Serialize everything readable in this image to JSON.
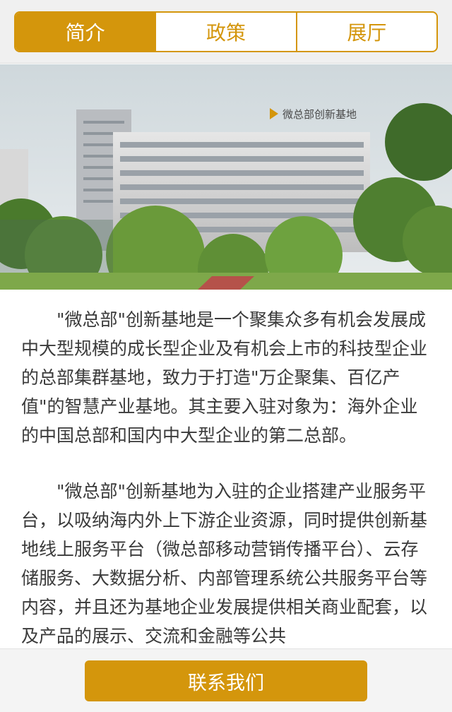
{
  "tabs": [
    {
      "label": "简介",
      "active": true
    },
    {
      "label": "政策",
      "active": false
    },
    {
      "label": "展厅",
      "active": false
    }
  ],
  "hero": {
    "sign_text": "微总部创新基地"
  },
  "content": {
    "paragraphs": [
      "\"微总部\"创新基地是一个聚集众多有机会发展成中大型规模的成长型企业及有机会上市的科技型企业的总部集群基地，致力于打造\"万企聚集、百亿产值\"的智慧产业基地。其主要入驻对象为：海外企业的中国总部和国内中大型企业的第二总部。",
      "\"微总部\"创新基地为入驻的企业搭建产业服务平台，以吸纳海内外上下游企业资源，同时提供创新基地线上服务平台（微总部移动营销传播平台）、云存储服务、大数据分析、内部管理系统公共服务平台等内容，并且还为基地企业发展提供相关商业配套，以及产品的展示、交流和金融等公共"
    ]
  },
  "footer": {
    "contact_label": "联系我们"
  },
  "colors": {
    "accent": "#d4960c",
    "text": "#3a3a3a"
  }
}
